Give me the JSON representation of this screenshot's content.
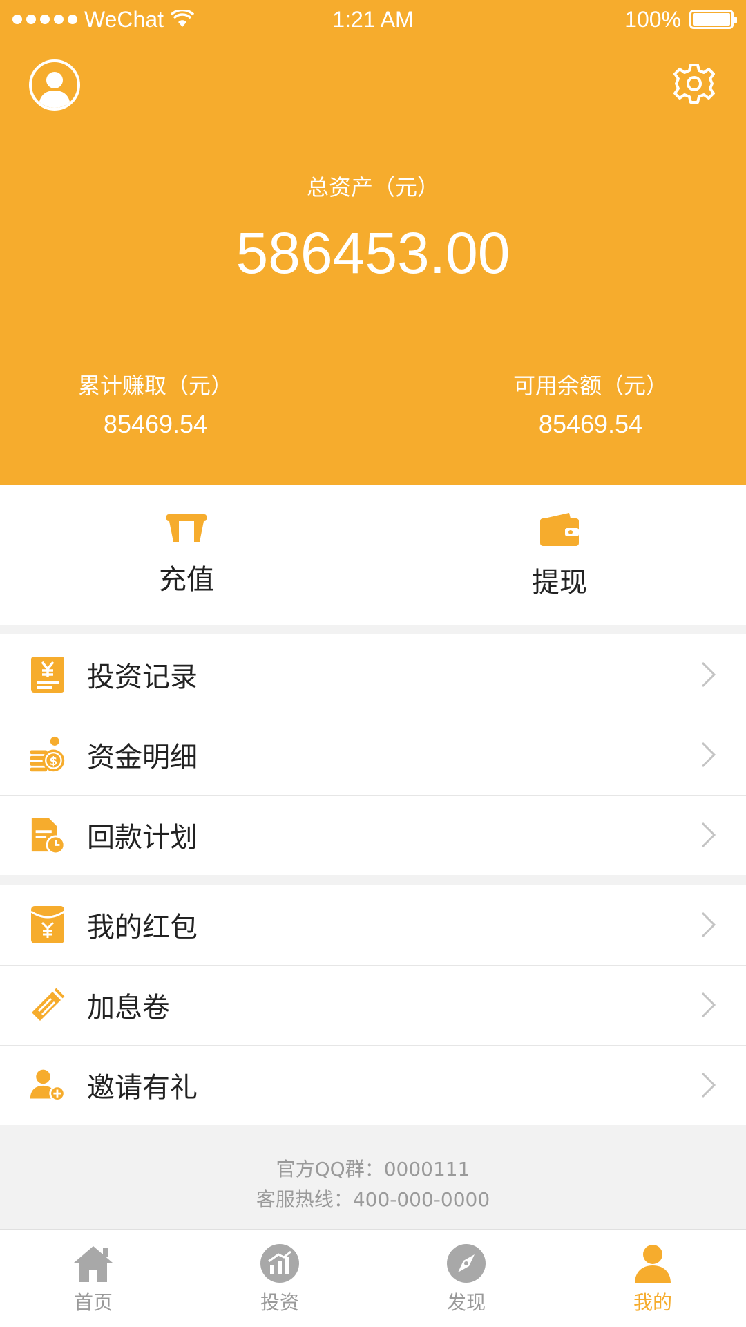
{
  "status_bar": {
    "carrier": "WeChat",
    "time": "1:21 AM",
    "battery": "100%",
    "battery_level": 1.0,
    "signal_bars": 5
  },
  "header": {
    "total_assets_label": "总资产（元）",
    "total_assets_value": "586453.00",
    "cumulative_earned_label": "累计赚取（元）",
    "cumulative_earned_value": "85469.54",
    "available_balance_label": "可用余额（元）",
    "available_balance_value": "85469.54"
  },
  "actions": {
    "recharge_label": "充值",
    "withdraw_label": "提现"
  },
  "menu_group_1": [
    {
      "label": "投资记录",
      "icon": "yen-document-icon"
    },
    {
      "label": "资金明细",
      "icon": "coins-icon"
    },
    {
      "label": "回款计划",
      "icon": "document-clock-icon"
    }
  ],
  "menu_group_2": [
    {
      "label": "我的红包",
      "icon": "red-envelope-icon"
    },
    {
      "label": "加息卷",
      "icon": "coupon-icon"
    },
    {
      "label": "邀请有礼",
      "icon": "invite-user-icon"
    }
  ],
  "footer": {
    "qq_group": "官方QQ群：0000111",
    "hotline": "客服热线：400-000-0000"
  },
  "tabs": [
    {
      "label": "首页",
      "icon": "home-icon",
      "active": false
    },
    {
      "label": "投资",
      "icon": "chart-icon",
      "active": false
    },
    {
      "label": "发现",
      "icon": "compass-icon",
      "active": false
    },
    {
      "label": "我的",
      "icon": "user-icon",
      "active": true
    }
  ],
  "colors": {
    "brand": "#F6AC2D",
    "inactive": "#9A9A9A",
    "background": "#F2F2F2"
  }
}
